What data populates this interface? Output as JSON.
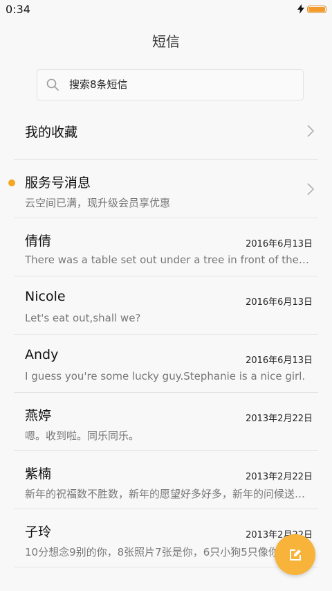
{
  "status": {
    "time": "0:34"
  },
  "header": {
    "title": "短信"
  },
  "search": {
    "placeholder": "搜索8条短信"
  },
  "favorites": {
    "label": "我的收藏"
  },
  "service": {
    "name": "服务号消息",
    "preview": "云空间已满，现升级会员享优惠"
  },
  "conversations": [
    {
      "name": "倩倩",
      "date": "2016年6月13日",
      "preview": "There was a table set out under a tree in front of the house"
    },
    {
      "name": "Nicole",
      "date": "2016年6月13日",
      "preview": "Let's eat out,shall we?"
    },
    {
      "name": "Andy",
      "date": "2016年6月13日",
      "preview": "I guess you're some lucky guy.Stephanie is a nice girl."
    },
    {
      "name": "燕婷",
      "date": "2013年2月22日",
      "preview": "嗯。收到啦。同乐同乐。"
    },
    {
      "name": "紫楠",
      "date": "2013年2月22日",
      "preview": "新年的祝福数不胜数，新年的愿望好多好多，新年的问候送给你"
    },
    {
      "name": "子玲",
      "date": "2013年2月22日",
      "preview": "10分想念9别的你，8张照片7张是你，6只小狗5只像你"
    }
  ],
  "colors": {
    "accent": "#f5a623",
    "fab": "#f7b33a",
    "battery": "#f29b2b"
  },
  "icons": {
    "search": "search-icon",
    "chevron": "chevron-right-icon",
    "compose": "compose-icon",
    "charging": "charging-icon",
    "battery": "battery-icon"
  }
}
